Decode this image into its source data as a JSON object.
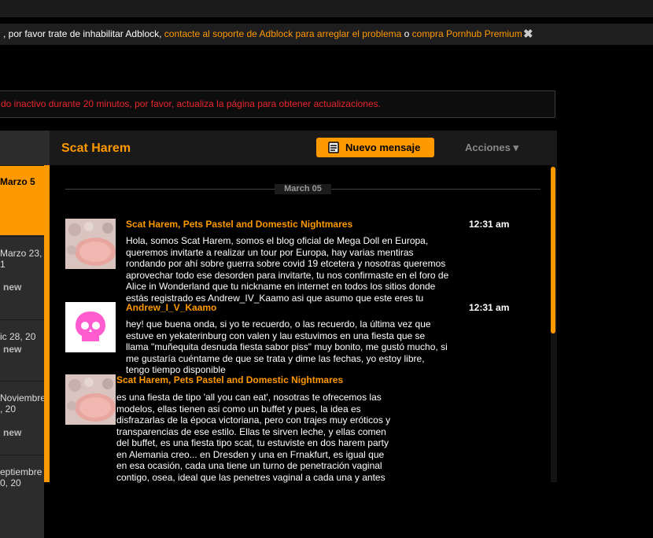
{
  "adblock": {
    "text1": ", por favor trate de inhabilitar Adblock, ",
    "link1": "contacte al soporte de Adblock para arreglar el problema",
    "text2": " o ",
    "link2": "compra Pornhub Premium",
    "close": "✖"
  },
  "alert": "do inactivo durante 20 minutos, por favor, actualiza la página para obtener actualizaciones.",
  "sidebar": {
    "items": [
      {
        "line1": "Marzo 5",
        "line2": "",
        "badge": ""
      },
      {
        "line1": "Marzo 23,",
        "line2": "1",
        "badge": "new"
      },
      {
        "line1": "ic 28, 20",
        "line2": "",
        "badge": "new"
      },
      {
        "line1": "Noviembre",
        "line2": ", 20",
        "badge": "new"
      },
      {
        "line1": "eptiembre",
        "line2": "0, 20",
        "badge": ""
      }
    ]
  },
  "header": {
    "title": "Scat Harem",
    "new_message": "Nuevo mensaje",
    "actions": "Acciones",
    "actions_arrow": "▾"
  },
  "thread": {
    "date": "March 05",
    "messages": [
      {
        "sender": "Scat Harem, Pets Pastel and Domestic Nightmares",
        "time": "12:31 am",
        "lines": [
          "Hola, somos Scat Harem, somos el blog oficial de Mega Doll en Europa,",
          "queremos invitarte a realizar un tour por Europa, hay varias mentiras",
          "rondando por ahí sobre guerra sobre covid 19 etcetera y nosotras queremos",
          "aprovechar todo ese desorden para invitarte, tu nos confirmaste en el foro de",
          "Alice in Wonderland que tu nickname en internet en todos los sitios donde",
          "estás registrado es Andrew_IV_Kaamo asi que asumo que este eres tu"
        ]
      },
      {
        "sender": "Andrew_I_V_Kaamo",
        "time": "12:31 am",
        "lines": [
          "hey! que buena onda, si yo te recuerdo, o las recuerdo, la última vez que",
          "estuve en yekaterinburg con valen y lau estuvimos en una fiesta que se",
          "llama \"muñequita desnuda fiesta sabor piss\" muy bonito, me gustó mucho, si",
          "me gustaría cuéntame de que se trata y dime las fechas, yo estoy libre,",
          "tengo tiempo disponible"
        ]
      },
      {
        "sender": "Scat Harem, Pets Pastel and Domestic Nightmares",
        "time": "",
        "lines": [
          "es una fiesta de tipo 'all you can eat', nosotras te ofrecemos las",
          "modelos, ellas tienen asi como un buffet y pues, la idea es",
          "disfrazarlas de la época victoriana, pero con trajes muy eróticos y",
          "transparencias de ese estilo. Ellas te sirven leche, y ellas comen",
          "del buffet, es una fiesta tipo scat, tu estuviste en dos harem party",
          "en Alemania creo... en Dresden y una en Frnakfurt, es igual que",
          "en esa ocasión, cada una tiene un turno de penetración vaginal",
          "contigo, osea, ideal que las penetres vaginal a cada una y antes"
        ]
      }
    ]
  },
  "colors": {
    "accent": "#ff9900",
    "alert": "#e8262d",
    "background": "#000000"
  },
  "icons": {
    "new_message": "message-icon",
    "close": "close-icon",
    "avatar2": "skull-icon"
  }
}
